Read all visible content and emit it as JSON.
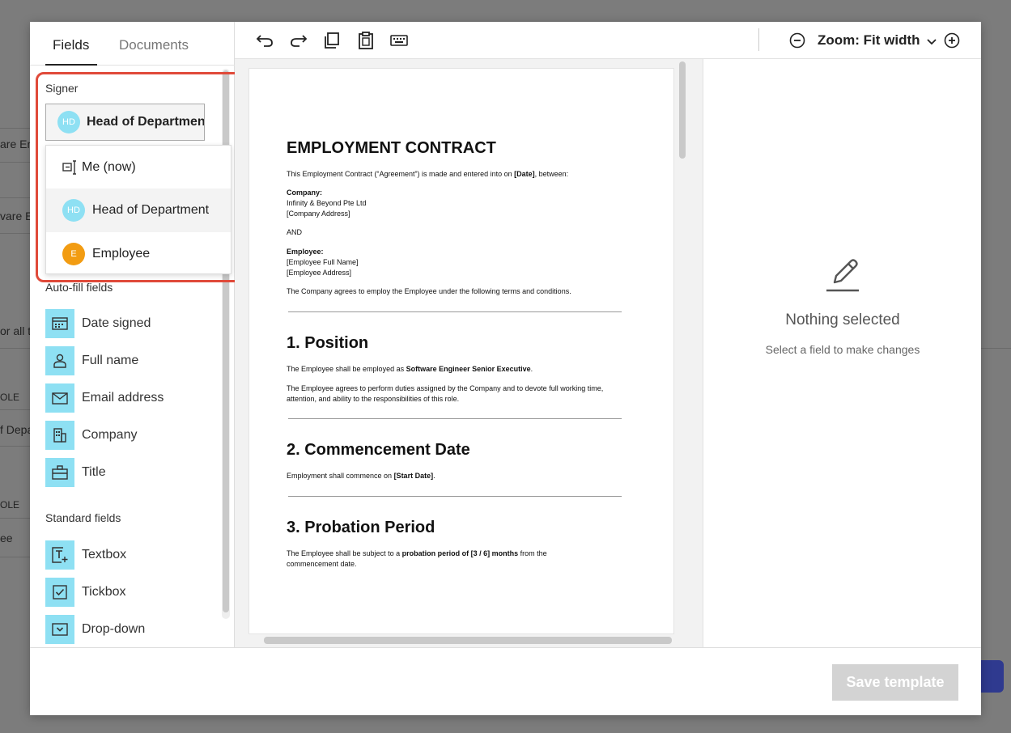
{
  "background": {
    "rows": [
      "are En",
      "vare E",
      "or all t",
      "OLE",
      "f Depa",
      "OLE",
      "ee"
    ]
  },
  "tabs": [
    {
      "label": "Fields"
    },
    {
      "label": "Documents"
    }
  ],
  "signer": {
    "label": "Signer",
    "selected": {
      "initials": "HD",
      "name": "Head of Department"
    },
    "options": [
      {
        "label": "Me (now)",
        "icon": "signature-pad-icon"
      },
      {
        "label": "Head of Department",
        "initials": "HD"
      },
      {
        "label": "Employee",
        "initials": "E"
      }
    ]
  },
  "autofill": {
    "label": "Auto-fill fields",
    "items": [
      {
        "label": "Date signed",
        "icon": "calendar-icon"
      },
      {
        "label": "Full name",
        "icon": "person-icon"
      },
      {
        "label": "Email address",
        "icon": "envelope-icon"
      },
      {
        "label": "Company",
        "icon": "building-icon"
      },
      {
        "label": "Title",
        "icon": "briefcase-icon"
      }
    ]
  },
  "standard": {
    "label": "Standard fields",
    "items": [
      {
        "label": "Textbox",
        "icon": "textbox-icon"
      },
      {
        "label": "Tickbox",
        "icon": "checkbox-icon"
      },
      {
        "label": "Drop-down",
        "icon": "dropdown-icon"
      }
    ]
  },
  "toolbar": {
    "icons": [
      "undo-icon",
      "redo-icon",
      "copy-icon",
      "paste-icon",
      "keyboard-icon"
    ],
    "zoom_label": "Zoom: Fit width",
    "zoom_out_icon": "minus-circle-icon",
    "zoom_in_icon": "plus-circle-icon"
  },
  "document": {
    "title": "EMPLOYMENT CONTRACT",
    "intro_pre": "This Employment Contract (“Agreement”) is made and entered into on ",
    "intro_bold": "[Date]",
    "intro_post": ", between:",
    "company_label": "Company:",
    "company_name": "Infinity & Beyond Pte Ltd",
    "company_address": "[Company Address]",
    "and": "AND",
    "employee_label": "Employee:",
    "employee_name": "[Employee Full Name]",
    "employee_address": "[Employee Address]",
    "agrees": "The Company agrees to employ the Employee under the following terms and conditions.",
    "s1_title": "1. Position",
    "s1_p1_pre": "The Employee shall be employed as ",
    "s1_p1_bold": "Software Engineer Senior Executive",
    "s1_p1_post": ".",
    "s1_p2": "The Employee agrees to perform duties assigned by the Company and to devote full working time, attention, and ability to the responsibilities of this role.",
    "s2_title": "2. Commencement Date",
    "s2_p_pre": "Employment shall commence on ",
    "s2_p_bold": "[Start Date]",
    "s2_p_post": ".",
    "s3_title": "3. Probation Period",
    "s3_p_pre": "The Employee shall be subject to a ",
    "s3_p_bold": "probation period of [3 / 6] months",
    "s3_p_post": " from the commencement date."
  },
  "right_panel": {
    "title": "Nothing selected",
    "subtitle": "Select a field to make changes"
  },
  "footer": {
    "save_label": "Save template"
  },
  "colors": {
    "field_icon_bg": "#8ee0f3",
    "employee_avatar": "#f29c12",
    "highlight_border": "#e04a3a",
    "disabled_button": "#d3d3d3"
  }
}
